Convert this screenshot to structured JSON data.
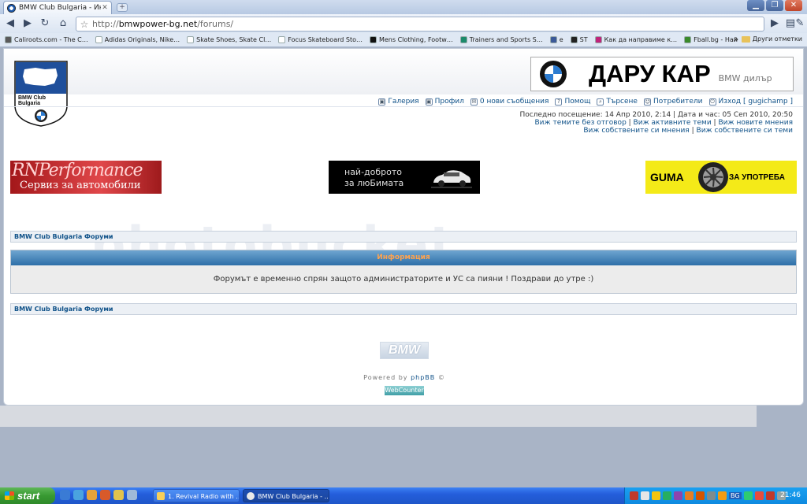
{
  "browser": {
    "tab_title": "BMW Club Bulgaria - Инфо…",
    "tab_close": "✕",
    "new_tab": "+",
    "url_scheme": "http://",
    "url_host": "bmwpower-bg.net",
    "url_path": "/forums/",
    "bookmarks": [
      {
        "label": "Caliroots.com - The C…",
        "color": "#5a5a5a"
      },
      {
        "label": "Adidas Originals, Nike…",
        "color": "#ffffff"
      },
      {
        "label": "Skate Shoes, Skate Cl…",
        "color": "#ffffff"
      },
      {
        "label": "Focus Skateboard Sto…",
        "color": "#ffffff"
      },
      {
        "label": "Mens Clothing, Footw…",
        "color": "#111111"
      },
      {
        "label": "Trainers and Sports S…",
        "color": "#1b8a6b"
      },
      {
        "label": "e",
        "color": "#3b5998"
      },
      {
        "label": "ST",
        "color": "#222222"
      },
      {
        "label": "Как да направиме к…",
        "color": "#c0237b"
      },
      {
        "label": "Fball.bg - Най-добри …",
        "color": "#3a8a2a"
      }
    ],
    "bookmarks_more": "»",
    "other_bookmarks": "Други отметки"
  },
  "header": {
    "logo_text_1": "BMW Club",
    "logo_text_2": "Bulgaria",
    "dealer_name": "ДАРУ КАР",
    "dealer_sub": "BMW дилър",
    "nav": [
      {
        "label": "Галерия",
        "icon": "gallery-icon"
      },
      {
        "label": "Профил",
        "icon": "profile-icon"
      },
      {
        "label": "0 нови съобщения",
        "icon": "messages-icon"
      },
      {
        "label": "Помощ",
        "icon": "help-icon"
      },
      {
        "label": "Търсене",
        "icon": "search-icon"
      },
      {
        "label": "Потребители",
        "icon": "users-icon"
      },
      {
        "label": "Изход [ gugichamp ]",
        "icon": "logout-icon"
      }
    ],
    "last_visit": "Последно посещение: 14 Апр 2010, 2:14 | Дата и час: 05 Сеп 2010, 20:50",
    "links_row1": [
      "Виж темите без отговор",
      "Виж активните теми",
      "Виж новите мнения"
    ],
    "links_row2": [
      "Виж собствените си мнения",
      "Виж собствените си теми"
    ],
    "separator": " | "
  },
  "banners": {
    "rn_big_1": "RN",
    "rn_big_2": "Performance",
    "rn_small": "Сервиз за автомобили",
    "merc_line1": "най-доброто",
    "merc_line2": "за люБимата",
    "guma_1": "GUMA",
    "guma_2": "ЗА УПОТРЕБА"
  },
  "watermark": "photobucket",
  "forum": {
    "breadcrumb": "BMW Club Bulgaria Форуми",
    "info_title": "Информация",
    "info_message": "Форумът е временно спрян защото администраторите и УС са пияни ! Поздрави до утре :)"
  },
  "footer": {
    "bmw_badge": "BMW",
    "powered_by": "Powered by",
    "powered_link": "phpBB",
    "powered_mark": "©",
    "webcounter": "WebCounter"
  },
  "taskbar": {
    "start": "start",
    "tasks": [
      "1. Revival Radio with …",
      "BMW Club Bulgaria - …"
    ],
    "language": "BG",
    "clock": "21:46"
  }
}
